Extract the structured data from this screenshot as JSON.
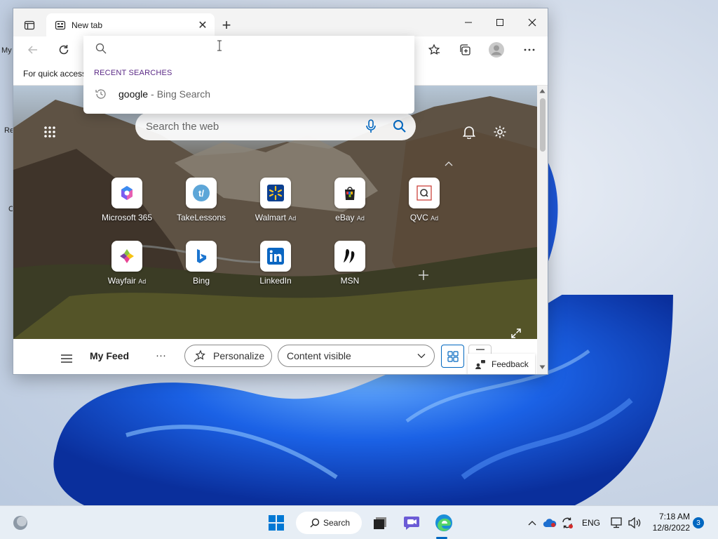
{
  "desktop": {
    "fragments": [
      "My",
      "Re",
      "C"
    ]
  },
  "browser": {
    "tab": {
      "title": "New tab",
      "close_glyph": "✕"
    },
    "new_tab_glyph": "+",
    "favorites_bar_text": "For quick access",
    "address_dropdown": {
      "recent_label": "RECENT SEARCHES",
      "items": [
        {
          "query": "google",
          "separator": "-",
          "source": "Bing Search"
        }
      ]
    },
    "newtab_page": {
      "search_placeholder": "Search the web",
      "tiles": [
        {
          "label": "Microsoft 365",
          "ad": "",
          "icon": "microsoft-365-icon"
        },
        {
          "label": "TakeLessons",
          "ad": "",
          "icon": "takelessons-icon"
        },
        {
          "label": "Walmart",
          "ad": "Ad",
          "icon": "walmart-icon"
        },
        {
          "label": "eBay",
          "ad": "Ad",
          "icon": "ebay-icon"
        },
        {
          "label": "QVC",
          "ad": "Ad",
          "icon": "qvc-icon"
        },
        {
          "label": "Wayfair",
          "ad": "Ad",
          "icon": "wayfair-icon"
        },
        {
          "label": "Bing",
          "ad": "",
          "icon": "bing-icon"
        },
        {
          "label": "LinkedIn",
          "ad": "",
          "icon": "linkedin-icon"
        },
        {
          "label": "MSN",
          "ad": "",
          "icon": "msn-icon"
        }
      ],
      "feed": {
        "title": "My Feed",
        "more_glyph": "···",
        "personalize_label": "Personalize",
        "content_select_value": "Content visible",
        "feedback_label": "Feedback"
      }
    }
  },
  "taskbar": {
    "search_label": "Search",
    "language": "ENG",
    "time": "7:18 AM",
    "date": "12/8/2022",
    "notification_count": "3"
  },
  "colors": {
    "accent": "#0067c0",
    "recent_label": "#5b2a86"
  }
}
